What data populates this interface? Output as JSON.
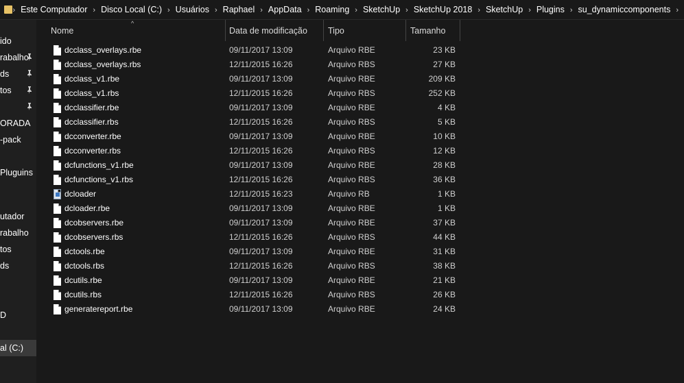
{
  "address": {
    "crumbs": [
      "Este Computador",
      "Disco Local (C:)",
      "Usuários",
      "Raphael",
      "AppData",
      "Roaming",
      "SketchUp",
      "SketchUp 2018",
      "SketchUp",
      "Plugins",
      "su_dynamiccomponents"
    ],
    "separator": "›"
  },
  "nav": {
    "items": [
      {
        "label": "ido",
        "pinned": false
      },
      {
        "label": "rabalho",
        "pinned": true
      },
      {
        "label": "ds",
        "pinned": true
      },
      {
        "label": "tos",
        "pinned": true
      },
      {
        "label": "",
        "pinned": true
      },
      {
        "label": "ORADA",
        "pinned": false
      },
      {
        "label": "-pack",
        "pinned": false
      },
      {
        "label": "",
        "pinned": false
      },
      {
        "label": " Pluguins",
        "pinned": false
      },
      {
        "label": "",
        "pinned": false
      },
      {
        "label": "",
        "pinned": false
      },
      {
        "label": "utador",
        "pinned": false
      },
      {
        "label": "rabalho",
        "pinned": false
      },
      {
        "label": "tos",
        "pinned": false
      },
      {
        "label": "ds",
        "pinned": false
      },
      {
        "label": "",
        "pinned": false
      },
      {
        "label": "",
        "pinned": false
      },
      {
        "label": "D",
        "pinned": false
      },
      {
        "label": "",
        "pinned": false
      },
      {
        "label": "al (C:)",
        "pinned": false,
        "selected": true
      }
    ],
    "pin_glyph": "📌"
  },
  "columns": {
    "name": "Nome",
    "date": "Data de modificação",
    "type": "Tipo",
    "size": "Tamanho",
    "sort_glyph": "^"
  },
  "files": [
    {
      "name": "dcclass_overlays.rbe",
      "date": "09/11/2017 13:09",
      "type": "Arquivo RBE",
      "size": "23 KB",
      "icon": "document-icon"
    },
    {
      "name": "dcclass_overlays.rbs",
      "date": "12/11/2015 16:26",
      "type": "Arquivo RBS",
      "size": "27 KB",
      "icon": "document-icon"
    },
    {
      "name": "dcclass_v1.rbe",
      "date": "09/11/2017 13:09",
      "type": "Arquivo RBE",
      "size": "209 KB",
      "icon": "document-icon"
    },
    {
      "name": "dcclass_v1.rbs",
      "date": "12/11/2015 16:26",
      "type": "Arquivo RBS",
      "size": "252 KB",
      "icon": "document-icon"
    },
    {
      "name": "dcclassifier.rbe",
      "date": "09/11/2017 13:09",
      "type": "Arquivo RBE",
      "size": "4 KB",
      "icon": "document-icon"
    },
    {
      "name": "dcclassifier.rbs",
      "date": "12/11/2015 16:26",
      "type": "Arquivo RBS",
      "size": "5 KB",
      "icon": "document-icon"
    },
    {
      "name": "dcconverter.rbe",
      "date": "09/11/2017 13:09",
      "type": "Arquivo RBE",
      "size": "10 KB",
      "icon": "document-icon"
    },
    {
      "name": "dcconverter.rbs",
      "date": "12/11/2015 16:26",
      "type": "Arquivo RBS",
      "size": "12 KB",
      "icon": "document-icon"
    },
    {
      "name": "dcfunctions_v1.rbe",
      "date": "09/11/2017 13:09",
      "type": "Arquivo RBE",
      "size": "28 KB",
      "icon": "document-icon"
    },
    {
      "name": "dcfunctions_v1.rbs",
      "date": "12/11/2015 16:26",
      "type": "Arquivo RBS",
      "size": "36 KB",
      "icon": "document-icon"
    },
    {
      "name": "dcloader",
      "date": "12/11/2015 16:23",
      "type": "Arquivo RB",
      "size": "1 KB",
      "icon": "ruby-file-icon"
    },
    {
      "name": "dcloader.rbe",
      "date": "09/11/2017 13:09",
      "type": "Arquivo RBE",
      "size": "1 KB",
      "icon": "document-icon"
    },
    {
      "name": "dcobservers.rbe",
      "date": "09/11/2017 13:09",
      "type": "Arquivo RBE",
      "size": "37 KB",
      "icon": "document-icon"
    },
    {
      "name": "dcobservers.rbs",
      "date": "12/11/2015 16:26",
      "type": "Arquivo RBS",
      "size": "44 KB",
      "icon": "document-icon"
    },
    {
      "name": "dctools.rbe",
      "date": "09/11/2017 13:09",
      "type": "Arquivo RBE",
      "size": "31 KB",
      "icon": "document-icon"
    },
    {
      "name": "dctools.rbs",
      "date": "12/11/2015 16:26",
      "type": "Arquivo RBS",
      "size": "38 KB",
      "icon": "document-icon"
    },
    {
      "name": "dcutils.rbe",
      "date": "09/11/2017 13:09",
      "type": "Arquivo RBE",
      "size": "21 KB",
      "icon": "document-icon"
    },
    {
      "name": "dcutils.rbs",
      "date": "12/11/2015 16:26",
      "type": "Arquivo RBS",
      "size": "26 KB",
      "icon": "document-icon"
    },
    {
      "name": "generatereport.rbe",
      "date": "09/11/2017 13:09",
      "type": "Arquivo RBE",
      "size": "24 KB",
      "icon": "document-icon"
    }
  ],
  "colors": {
    "background": "#191919",
    "nav_background": "#1f1f1f",
    "selected": "#3a3a3a",
    "folder": "#e8c266"
  }
}
